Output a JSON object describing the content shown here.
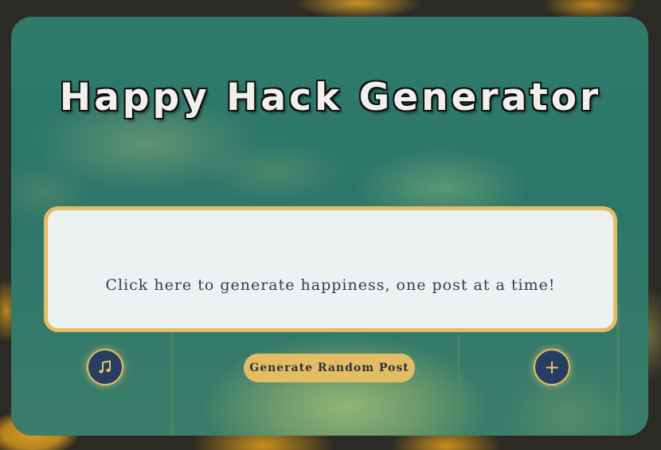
{
  "header": {
    "title": "Happy Hack Generator"
  },
  "post": {
    "text": "Click here to generate happiness, one post at a time!"
  },
  "controls": {
    "generate_label": "Generate Random Post",
    "music_icon": "music-note-icon",
    "add_icon": "plus-icon",
    "add_glyph": "+"
  },
  "colors": {
    "accent": "#e2bd67",
    "button_dark": "#273e63",
    "panel": "#2f786b",
    "card": "#ecf1f1",
    "text_dark": "#2f4152"
  }
}
